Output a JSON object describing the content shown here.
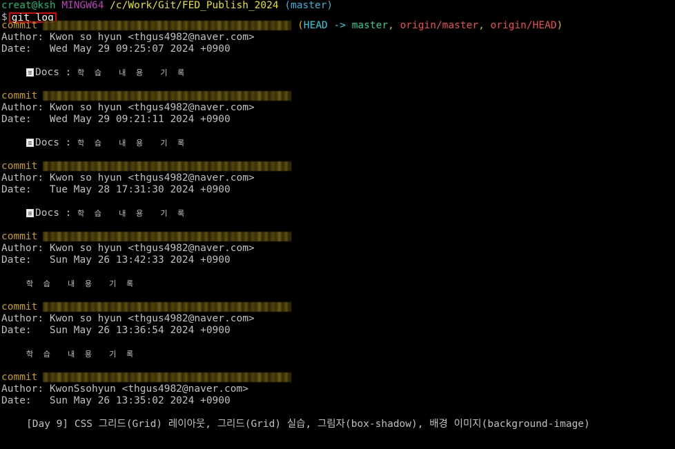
{
  "prompt": {
    "user_host": "creat@ksh",
    "system": "MINGW64",
    "path": "/c/Work/Git/FED_Publish_2024",
    "branch": "(master)",
    "symbol": "$",
    "command": "git log"
  },
  "colors": {
    "background": "#000000",
    "text": "#c0c0c0",
    "commit_keyword": "#c8a000",
    "highlight_box": "#e00000"
  },
  "head_ref": {
    "open": "(",
    "head": "HEAD -> ",
    "master": "master",
    "sep1": ", ",
    "origin_master": "origin/master",
    "sep2": ", ",
    "origin_head": "origin/HEAD",
    "close": ")"
  },
  "commits": [
    {
      "keyword": "commit",
      "author_label": "Author:",
      "author": "Kwon so hyun <thgus4982@naver.com>",
      "date_label": "Date:",
      "date": "Wed May 29 09:25:07 2024 +0900",
      "message_prefix": "Docs : ",
      "message": "학 습  내 용  기 록"
    },
    {
      "keyword": "commit",
      "author_label": "Author:",
      "author": "Kwon so hyun <thgus4982@naver.com>",
      "date_label": "Date:",
      "date": "Wed May 29 09:21:11 2024 +0900",
      "message_prefix": "Docs : ",
      "message": "학 습  내 용  기 록"
    },
    {
      "keyword": "commit",
      "author_label": "Author:",
      "author": "Kwon so hyun <thgus4982@naver.com>",
      "date_label": "Date:",
      "date": "Tue May 28 17:31:30 2024 +0900",
      "message_prefix": "Docs : ",
      "message": "학 습  내 용  기 록"
    },
    {
      "keyword": "commit",
      "author_label": "Author:",
      "author": "Kwon so hyun <thgus4982@naver.com>",
      "date_label": "Date:",
      "date": "Sun May 26 13:42:33 2024 +0900",
      "message": "학 습  내 용  기 록"
    },
    {
      "keyword": "commit",
      "author_label": "Author:",
      "author": "Kwon so hyun <thgus4982@naver.com>",
      "date_label": "Date:",
      "date": "Sun May 26 13:36:54 2024 +0900",
      "message": "학 습  내 용  기 록"
    },
    {
      "keyword": "commit",
      "author_label": "Author:",
      "author": "KwonSsohyun <thgus4982@naver.com>",
      "date_label": "Date:",
      "date": "Sun May 26 13:35:02 2024 +0900",
      "message": "[Day 9] CSS 그리드(Grid) 레이아웃, 그리드(Grid) 실습, 그림자(box-shadow), 배경 이미지(background-image)"
    }
  ]
}
